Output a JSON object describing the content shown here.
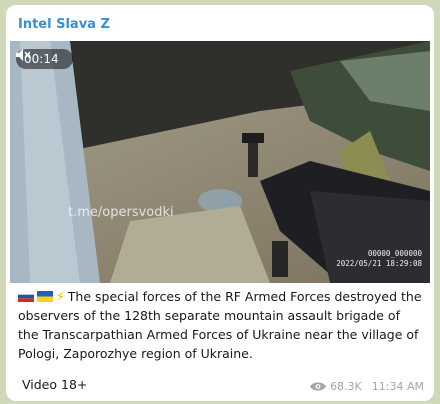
{
  "channel": {
    "name": "Intel Slava Z"
  },
  "video": {
    "duration": "00:14",
    "muted_icon": "speaker-muted-icon",
    "watermark": "t.me/opersvodki",
    "cam_id": "00000_000000",
    "cam_timestamp": "2022/05/21 18:29:08"
  },
  "message": {
    "flags": [
      "russia-flag-icon",
      "ukraine-flag-icon",
      "lightning-icon"
    ],
    "text": "The special forces of the RF Armed Forces destroyed the observers of the 128th separate mountain assault brigade of the Transcarpathian Armed Forces of Ukraine near the village of Pologi, Zaporozhye region of Ukraine.",
    "tag": "Video 18+"
  },
  "meta": {
    "views_icon": "eye-icon",
    "views": "68.3K",
    "time": "11:34 AM"
  }
}
